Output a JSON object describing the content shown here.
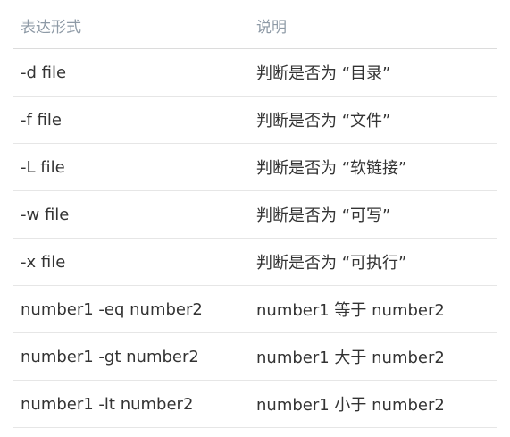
{
  "table": {
    "headers": [
      "表达形式",
      "说明"
    ],
    "rows": [
      [
        "-d file",
        "判断是否为 “目录”"
      ],
      [
        "-f file",
        "判断是否为 “文件”"
      ],
      [
        "-L file",
        "判断是否为 “软链接”"
      ],
      [
        "-w file",
        "判断是否为 “可写”"
      ],
      [
        "-x file",
        "判断是否为 “可执行”"
      ],
      [
        "number1 -eq number2",
        "number1 等于 number2"
      ],
      [
        "number1 -gt number2",
        "number1 大于 number2"
      ],
      [
        "number1 -lt number2",
        "number1 小于 number2"
      ]
    ]
  }
}
